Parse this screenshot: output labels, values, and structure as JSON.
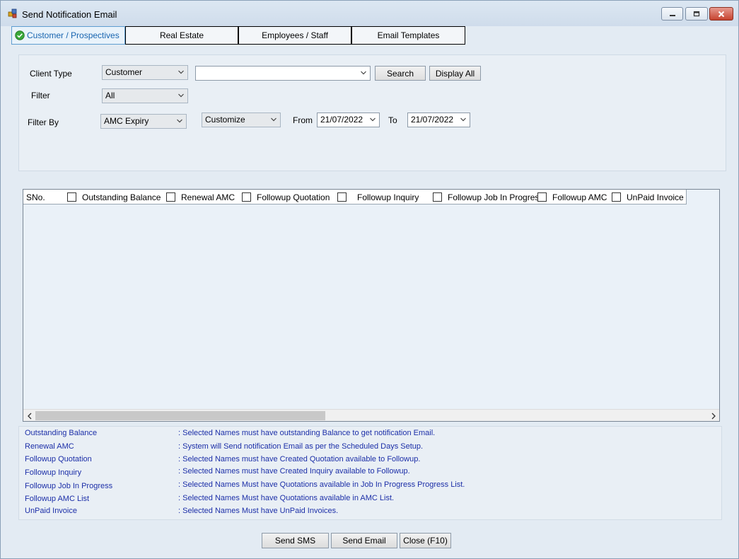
{
  "window": {
    "title": "Send Notification Email",
    "colors": {
      "accent": "#1865b0",
      "legend_text": "#1c2fa8",
      "close_red": "#c6432f"
    }
  },
  "tabs": [
    {
      "label": "Customer / Prospectives",
      "active": true
    },
    {
      "label": "Real Estate",
      "active": false
    },
    {
      "label": "Employees / Staff",
      "active": false
    },
    {
      "label": "Email Templates",
      "active": false
    }
  ],
  "filters": {
    "client_type_label": "Client Type",
    "client_type_value": "Customer",
    "search_value": "",
    "search_button": "Search",
    "display_all_button": "Display All",
    "filter_label": "Filter",
    "filter_value": "All",
    "filter_by_label": "Filter By",
    "filter_by_value": "AMC Expiry",
    "range_value": "Customize",
    "from_label": "From",
    "from_date": "21/07/2022",
    "to_label": "To",
    "to_date": "21/07/2022"
  },
  "grid": {
    "sno_header": "SNo.",
    "columns": [
      {
        "label": "Outstanding Balance",
        "checked": false
      },
      {
        "label": "Renewal AMC",
        "checked": false
      },
      {
        "label": "Followup Quotation",
        "checked": false
      },
      {
        "label": "Followup Inquiry",
        "checked": false
      },
      {
        "label": "Followup Job In Progress",
        "checked": false
      },
      {
        "label": "Followup AMC",
        "checked": false
      },
      {
        "label": "UnPaid Invoice",
        "checked": false
      }
    ],
    "rows": []
  },
  "legend": [
    {
      "name": "Outstanding Balance",
      "desc": ": Selected Names must have outstanding Balance to get notification Email."
    },
    {
      "name": "Renewal AMC",
      "desc": ": System will Send notification Email as per the Scheduled Days Setup."
    },
    {
      "name": "Followup Quotation",
      "desc": ": Selected Names must have Created Quotation available to Followup."
    },
    {
      "name": "Followup Inquiry",
      "desc": ": Selected Names must have Created Inquiry available to Followup."
    },
    {
      "name": "Followup Job In Progress",
      "desc": ": Selected Names Must have Quotations available in Job In Progress Progress List."
    },
    {
      "name": "Followup AMC List",
      "desc": ": Selected Names Must have Quotations available in AMC List."
    },
    {
      "name": "UnPaid Invoice",
      "desc": ": Selected Names Must have UnPaid Invoices."
    }
  ],
  "actions": {
    "send_sms": "Send SMS",
    "send_email": "Send Email",
    "close": "Close (F10)"
  }
}
